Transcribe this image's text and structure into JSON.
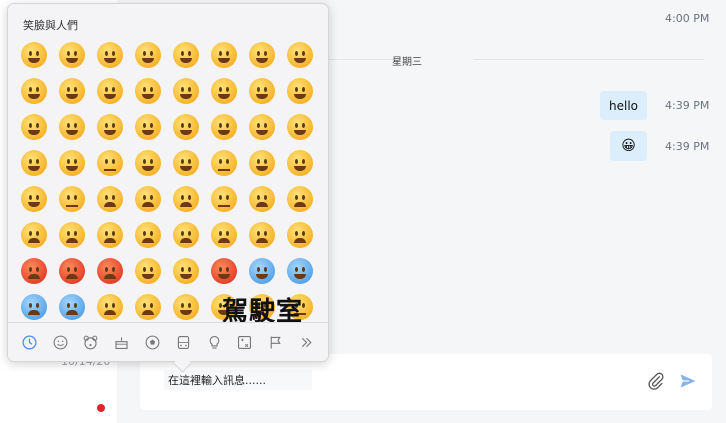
{
  "left_panel": {
    "date": "10/14/20"
  },
  "chat": {
    "top_time": "4:00 PM",
    "day_divider": "星期三",
    "messages": [
      {
        "text": "hello",
        "time": "4:39 PM"
      },
      {
        "text": "😀",
        "time": "4:39 PM"
      }
    ]
  },
  "composer": {
    "placeholder": "在這裡輸入訊息......"
  },
  "emoji_picker": {
    "title": "笑臉與人們",
    "overlay_text": "駕駛室",
    "emojis": [
      "😀",
      "😃",
      "😄",
      "😁",
      "😆",
      "😅",
      "😂",
      "🤣",
      "☺️",
      "😊",
      "😇",
      "🙂",
      "🙃",
      "😉",
      "😌",
      "😍",
      "🥰",
      "😘",
      "😗",
      "😙",
      "😚",
      "😋",
      "😛",
      "😝",
      "😜",
      "🤪",
      "🤨",
      "🧐",
      "🤓",
      "😎",
      "🤩",
      "🥳",
      "😏",
      "😒",
      "😞",
      "😔",
      "😟",
      "😕",
      "🙁",
      "☹️",
      "😣",
      "😖",
      "😫",
      "😩",
      "🥺",
      "😢",
      "😭",
      "😤",
      "😠",
      "😡",
      "🤬",
      "🤯",
      "😳",
      "🥵",
      "🥶",
      "😱",
      "😨",
      "😰",
      "😥",
      "😓",
      "🤗",
      "🤔",
      "🤭",
      "🤫"
    ],
    "categories": [
      {
        "name": "recent",
        "icon": "clock-icon"
      },
      {
        "name": "smileys",
        "icon": "smiley-icon"
      },
      {
        "name": "animals",
        "icon": "bear-icon"
      },
      {
        "name": "food",
        "icon": "cake-icon"
      },
      {
        "name": "activity",
        "icon": "soccer-ball-icon"
      },
      {
        "name": "travel",
        "icon": "car-icon"
      },
      {
        "name": "objects",
        "icon": "lightbulb-icon"
      },
      {
        "name": "symbols",
        "icon": "symbols-icon"
      },
      {
        "name": "flags",
        "icon": "flag-icon"
      },
      {
        "name": "more",
        "icon": "chevron-double-right-icon"
      }
    ]
  },
  "colors": {
    "accent": "#4a90e2",
    "bubble": "#dcedfb",
    "alert": "#e0242c"
  }
}
